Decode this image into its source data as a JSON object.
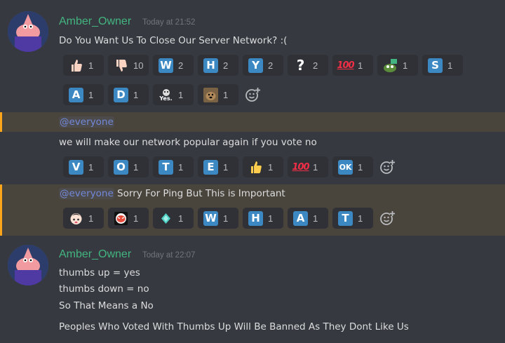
{
  "messages": [
    {
      "author": "Amber_Owner",
      "timestamp": "Today at 21:52",
      "text": "Do You Want Us To Close Our Server Network? :(",
      "reactions_row1": [
        {
          "emoji": "thumbs-up",
          "count": "1"
        },
        {
          "emoji": "thumbs-down",
          "count": "10"
        },
        {
          "emoji": "regional-w",
          "glyph": "W",
          "count": "2"
        },
        {
          "emoji": "regional-h",
          "glyph": "H",
          "count": "2"
        },
        {
          "emoji": "regional-y",
          "glyph": "Y",
          "count": "2"
        },
        {
          "emoji": "question",
          "glyph": "?",
          "count": "2"
        },
        {
          "emoji": "hundred",
          "glyph": "100",
          "count": "1"
        },
        {
          "emoji": "pepe-yes",
          "count": "1"
        },
        {
          "emoji": "regional-s",
          "glyph": "S",
          "count": "1"
        }
      ],
      "reactions_row2": [
        {
          "emoji": "regional-a",
          "glyph": "A",
          "count": "1"
        },
        {
          "emoji": "regional-d",
          "glyph": "D",
          "count": "1"
        },
        {
          "emoji": "yes-custom",
          "glyph": "Yes.",
          "count": "1"
        },
        {
          "emoji": "dog-custom",
          "count": "1"
        }
      ]
    },
    {
      "mention": "@everyone",
      "text": "we will make our network popular again if you vote no",
      "reactions": [
        {
          "emoji": "regional-v",
          "glyph": "V",
          "count": "1"
        },
        {
          "emoji": "regional-o",
          "glyph": "O",
          "count": "1"
        },
        {
          "emoji": "regional-t",
          "glyph": "T",
          "count": "1"
        },
        {
          "emoji": "regional-e",
          "glyph": "E",
          "count": "1"
        },
        {
          "emoji": "thumbs-up-yellow",
          "count": "1"
        },
        {
          "emoji": "hundred",
          "glyph": "100",
          "count": "1"
        },
        {
          "emoji": "ok-button",
          "glyph": "OK",
          "count": "1"
        }
      ]
    },
    {
      "mention": "@everyone",
      "text": " Sorry For Ping But This is Important",
      "reactions": [
        {
          "emoji": "anime-girl",
          "count": "1"
        },
        {
          "emoji": "red-face-custom",
          "count": "1"
        },
        {
          "emoji": "diamond-custom",
          "count": "1"
        },
        {
          "emoji": "regional-w",
          "glyph": "W",
          "count": "1"
        },
        {
          "emoji": "regional-h",
          "glyph": "H",
          "count": "1"
        },
        {
          "emoji": "regional-a",
          "glyph": "A",
          "count": "1"
        },
        {
          "emoji": "regional-t",
          "glyph": "T",
          "count": "1"
        }
      ]
    },
    {
      "author": "Amber_Owner",
      "timestamp": "Today at 22:07",
      "lines": [
        "thumbs up = yes",
        "thumbs down = no",
        "So That Means a No",
        "Peoples Who Voted With Thumbs Up Will Be Banned As They Dont Like Us"
      ]
    }
  ],
  "colors": {
    "background": "#36393f",
    "username": "#43b581",
    "mention_highlight": "#49443c",
    "mention_bar": "#faa61a",
    "regional_indicator": "#3b88c3"
  }
}
